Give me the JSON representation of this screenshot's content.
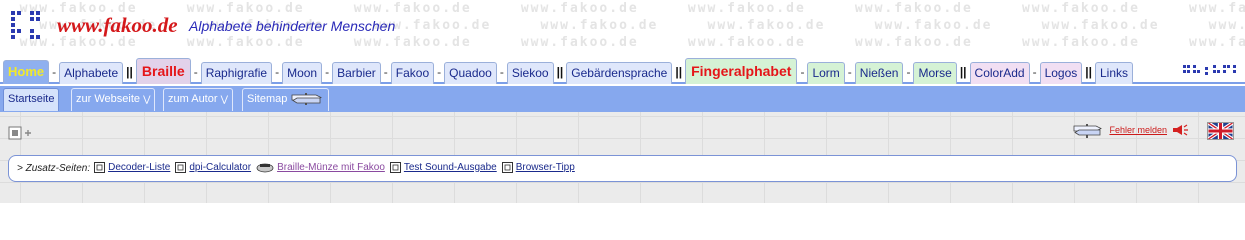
{
  "header": {
    "site_name": "www.fakoo.de",
    "subtitle": "Alphabete behinderter Menschen",
    "watermark_text": "www.fakoo.de"
  },
  "tabs": [
    {
      "label": "Home",
      "style": "home"
    },
    {
      "sep": "-"
    },
    {
      "label": "Alphabete"
    },
    {
      "sep": "||"
    },
    {
      "label": "Braille",
      "style": "big braille"
    },
    {
      "sep": "-"
    },
    {
      "label": "Raphigrafie"
    },
    {
      "sep": "-"
    },
    {
      "label": "Moon"
    },
    {
      "sep": "-"
    },
    {
      "label": "Barbier"
    },
    {
      "sep": "-"
    },
    {
      "label": "Fakoo"
    },
    {
      "sep": "-"
    },
    {
      "label": "Quadoo"
    },
    {
      "sep": "-"
    },
    {
      "label": "Siekoo"
    },
    {
      "sep": "||"
    },
    {
      "label": "Gebärdensprache"
    },
    {
      "sep": "||"
    },
    {
      "label": "Fingeralphabet",
      "style": "big finger"
    },
    {
      "sep": "-"
    },
    {
      "label": "Lorm",
      "style": "green"
    },
    {
      "sep": "-"
    },
    {
      "label": "Nießen",
      "style": "green"
    },
    {
      "sep": "-"
    },
    {
      "label": "Morse",
      "style": "green"
    },
    {
      "sep": "||"
    },
    {
      "label": "ColorAdd",
      "style": "purple"
    },
    {
      "sep": "-"
    },
    {
      "label": "Logos",
      "style": "purple"
    },
    {
      "sep": "||"
    },
    {
      "label": "Links"
    }
  ],
  "subtabs": {
    "startseite": "Startseite",
    "webseite": "zur Webseite",
    "autor": "zum Autor",
    "sitemap": "Sitemap"
  },
  "report": {
    "label": "Fehler melden"
  },
  "pages": {
    "label": "> Zusatz-Seiten:",
    "items": [
      {
        "label": "Decoder-Liste",
        "icon": "page-icon",
        "visited": false
      },
      {
        "label": "dpi-Calculator",
        "icon": "page-icon",
        "visited": false
      },
      {
        "label": "Braille-Münze mit Fakoo",
        "icon": "coin-icon",
        "visited": true
      },
      {
        "label": "Test Sound-Ausgabe",
        "icon": "page-icon",
        "visited": false
      },
      {
        "label": "Browser-Tipp",
        "icon": "page-icon",
        "visited": false
      }
    ]
  },
  "colors": {
    "accent": "#86a8ee",
    "brand_red": "#d4181b",
    "link": "#1a2a8c"
  }
}
